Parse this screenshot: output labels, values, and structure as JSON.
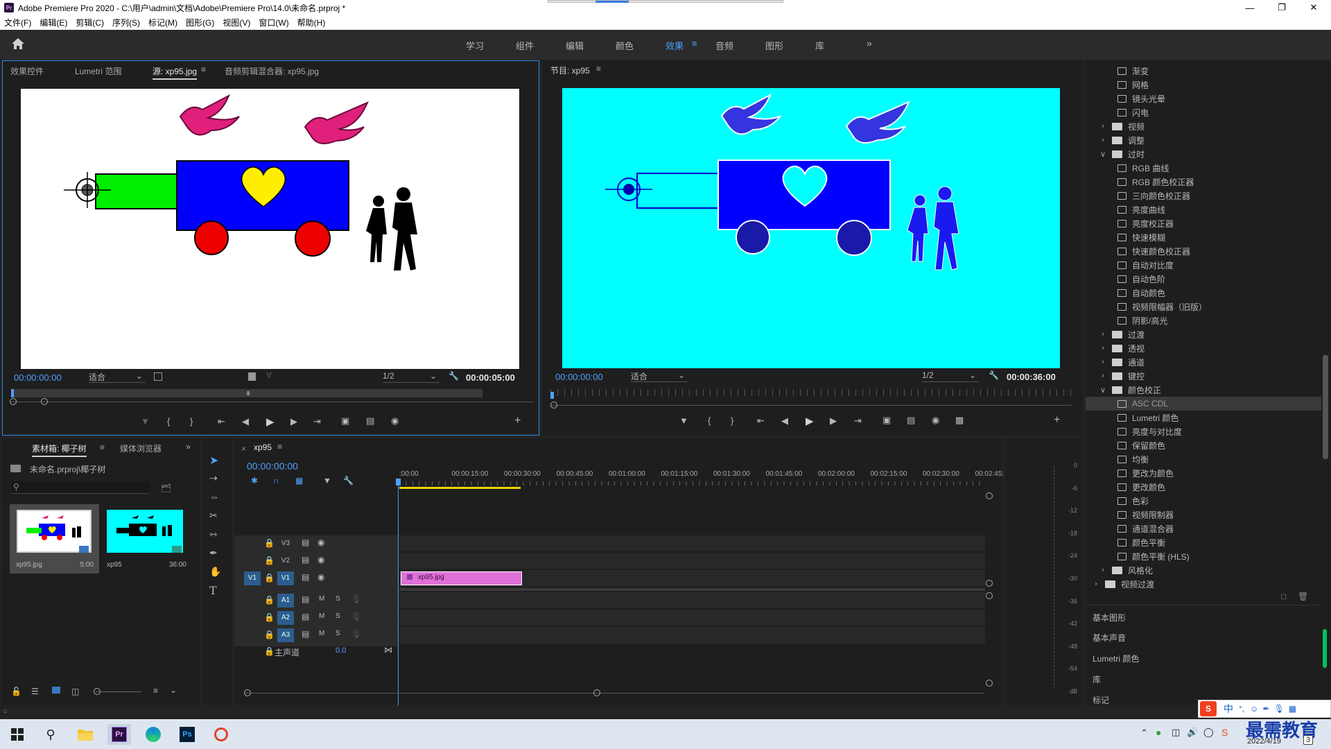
{
  "window": {
    "title": "Adobe Premiere Pro 2020 - C:\\用户\\admin\\文档\\Adobe\\Premiere Pro\\14.0\\未命名.prproj *",
    "logo": "Pr"
  },
  "menu": [
    "文件(F)",
    "编辑(E)",
    "剪辑(C)",
    "序列(S)",
    "标记(M)",
    "图形(G)",
    "视图(V)",
    "窗口(W)",
    "帮助(H)"
  ],
  "workspaces": [
    "学习",
    "组件",
    "编辑",
    "颜色",
    "效果",
    "音频",
    "图形",
    "库"
  ],
  "active_workspace": "效果",
  "source_panel": {
    "tabs": [
      "效果控件",
      "Lumetri 范围",
      "源: xp95.jpg",
      "音频剪辑混合器: xp95.jpg"
    ],
    "active_tab": "源: xp95.jpg",
    "timecode": "00:00:00:00",
    "fit": "适合",
    "resolution": "1/2",
    "duration": "00:00:05:00"
  },
  "program_panel": {
    "title": "节目: xp95",
    "timecode": "00:00:00:00",
    "fit": "适合",
    "resolution": "1/2",
    "duration": "00:00:36:00"
  },
  "project_panel": {
    "tabs": [
      "素材箱: 椰子树",
      "媒体浏览器"
    ],
    "path": "未命名.prproj\\椰子树",
    "items": [
      {
        "name": "xp95.jpg",
        "duration": "5:00"
      },
      {
        "name": "xp95",
        "duration": "36:00"
      }
    ]
  },
  "timeline": {
    "tab": "xp95",
    "timecode": "00:00:00:00",
    "ruler": [
      ":00:00",
      "00:00:15:00",
      "00:00:30:00",
      "00:00:45:00",
      "00:01:00:00",
      "00:01:15:00",
      "00:01:30:00",
      "00:01:45:00",
      "00:02:00:00",
      "00:02:15:00",
      "00:02:30:00",
      "00:02:45:"
    ],
    "video_tracks": [
      "V3",
      "V2",
      "V1"
    ],
    "audio_tracks": [
      "A1",
      "A2",
      "A3"
    ],
    "source_patch": "V1",
    "master": "主声道",
    "master_value": "0.0",
    "clip": "xp95.jpg",
    "m": "M",
    "s": "S"
  },
  "meter": {
    "scale": [
      "0",
      "-6",
      "-12",
      "-18",
      "-24",
      "-30",
      "-36",
      "-42",
      "-48",
      "-54",
      "dB"
    ]
  },
  "effects_tree": [
    {
      "label": "渐变",
      "kind": "item",
      "level": 2
    },
    {
      "label": "网格",
      "kind": "item",
      "level": 2
    },
    {
      "label": "镜头光晕",
      "kind": "item",
      "level": 2
    },
    {
      "label": "闪电",
      "kind": "item",
      "level": 2
    },
    {
      "label": "视频",
      "kind": "folder",
      "level": 1,
      "open": false
    },
    {
      "label": "调整",
      "kind": "folder",
      "level": 1,
      "open": false
    },
    {
      "label": "过时",
      "kind": "folder",
      "level": 1,
      "open": true
    },
    {
      "label": "RGB 曲线",
      "kind": "item",
      "level": 2
    },
    {
      "label": "RGB 颜色校正器",
      "kind": "item",
      "level": 2
    },
    {
      "label": "三向颜色校正器",
      "kind": "item",
      "level": 2
    },
    {
      "label": "亮度曲线",
      "kind": "item",
      "level": 2
    },
    {
      "label": "亮度校正器",
      "kind": "item",
      "level": 2
    },
    {
      "label": "快速模糊",
      "kind": "item",
      "level": 2
    },
    {
      "label": "快速颜色校正器",
      "kind": "item",
      "level": 2
    },
    {
      "label": "自动对比度",
      "kind": "item",
      "level": 2
    },
    {
      "label": "自动色阶",
      "kind": "item",
      "level": 2
    },
    {
      "label": "自动颜色",
      "kind": "item",
      "level": 2
    },
    {
      "label": "视频限幅器（旧版）",
      "kind": "item",
      "level": 2
    },
    {
      "label": "阴影/高光",
      "kind": "item",
      "level": 2
    },
    {
      "label": "过渡",
      "kind": "folder",
      "level": 1,
      "open": false
    },
    {
      "label": "透视",
      "kind": "folder",
      "level": 1,
      "open": false
    },
    {
      "label": "通道",
      "kind": "folder",
      "level": 1,
      "open": false
    },
    {
      "label": "键控",
      "kind": "folder",
      "level": 1,
      "open": false
    },
    {
      "label": "颜色校正",
      "kind": "folder",
      "level": 1,
      "open": true
    },
    {
      "label": "ASC CDL",
      "kind": "item",
      "level": 2,
      "selected": true
    },
    {
      "label": "Lumetri 颜色",
      "kind": "item",
      "level": 2
    },
    {
      "label": "亮度与对比度",
      "kind": "item",
      "level": 2
    },
    {
      "label": "保留颜色",
      "kind": "item",
      "level": 2
    },
    {
      "label": "均衡",
      "kind": "item",
      "level": 2
    },
    {
      "label": "更改为颜色",
      "kind": "item",
      "level": 2
    },
    {
      "label": "更改颜色",
      "kind": "item",
      "level": 2
    },
    {
      "label": "色彩",
      "kind": "item",
      "level": 2
    },
    {
      "label": "视频限制器",
      "kind": "item",
      "level": 2
    },
    {
      "label": "通道混合器",
      "kind": "item",
      "level": 2
    },
    {
      "label": "颜色平衡",
      "kind": "item",
      "level": 2
    },
    {
      "label": "颜色平衡 (HLS)",
      "kind": "item",
      "level": 2
    },
    {
      "label": "风格化",
      "kind": "folder",
      "level": 1,
      "open": false
    },
    {
      "label": "视频过渡",
      "kind": "folder",
      "level": 0,
      "open": false
    }
  ],
  "right_sections": [
    "基本图形",
    "基本声音",
    "Lumetri 颜色",
    "库",
    "标记"
  ],
  "taskbar": {
    "date": "2022/4/19",
    "ime": "中",
    "watermark": "最需教育",
    "notification": "3"
  },
  "colors": {
    "accent": "#4ea0ff",
    "program_bg": "#00ffff",
    "clip": "#e070d8",
    "workarea": "#e8d400"
  }
}
